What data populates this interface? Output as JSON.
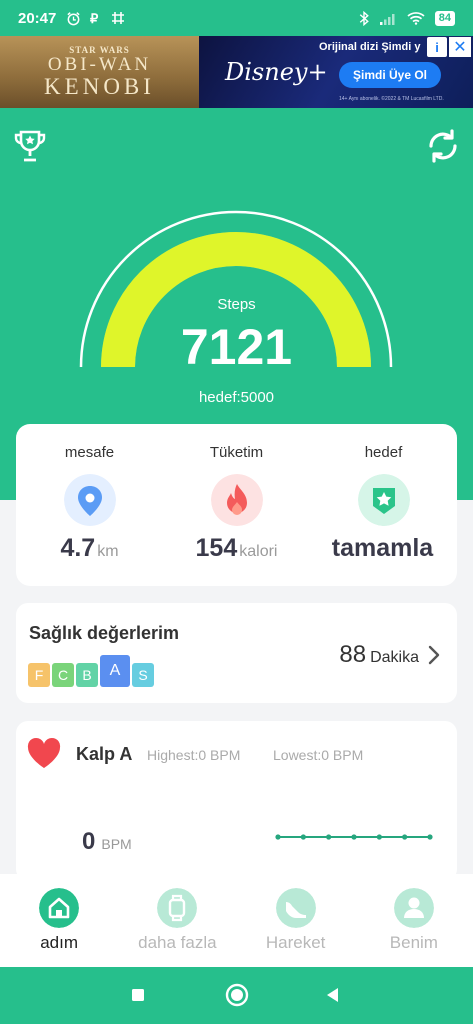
{
  "status_bar": {
    "time": "20:47",
    "left_icons": [
      "alarm-icon",
      "p-icon",
      "grid-icon"
    ],
    "right_icons": [
      "bluetooth-icon",
      "signal-icon",
      "wifi-icon"
    ],
    "battery": "84"
  },
  "ad": {
    "left_small": "STAR WARS",
    "left_line1": "OBI-WAN",
    "left_line2": "KENOBI",
    "brand": "Disney+",
    "top_text": "Orijinal dizi Şimdi y",
    "cta": "Şimdi Üye Ol",
    "fine_print": "14+ Aynı abonelik. ©2022 & TM Lucasfilm LTD."
  },
  "header": {
    "left_button_icon": "trophy-icon",
    "right_button_icon": "refresh-icon"
  },
  "gauge": {
    "label": "Steps",
    "value": "7121",
    "goal_text": "hedef:5000",
    "steps": 7121,
    "goal": 5000,
    "progress_fraction": 1.0,
    "arc_color": "#dff52a",
    "track_color": "#ffffff"
  },
  "stats": [
    {
      "label": "mesafe",
      "value": "4.7",
      "unit": "km",
      "icon": "location-pin-icon",
      "color": "#5b9cf5"
    },
    {
      "label": "Tüketim",
      "value": "154",
      "unit": "kalori",
      "icon": "flame-icon",
      "color": "#f45b5b"
    },
    {
      "label": "hedef",
      "value": "tamamla",
      "unit": "",
      "icon": "star-badge-icon",
      "color": "#2bc48a"
    }
  ],
  "health": {
    "title": "Sağlık değerlerim",
    "grades": [
      {
        "letter": "F",
        "color": "#f6c36a",
        "active": false
      },
      {
        "letter": "C",
        "color": "#7ad47a",
        "active": false
      },
      {
        "letter": "B",
        "color": "#62d3a6",
        "active": false
      },
      {
        "letter": "A",
        "color": "#5b8ff0",
        "active": true
      },
      {
        "letter": "S",
        "color": "#66cde0",
        "active": false
      }
    ],
    "value": "88",
    "unit": "Dakika"
  },
  "heart": {
    "title": "Kalp A",
    "highest": "Highest:0  BPM",
    "lowest": "Lowest:0  BPM",
    "bpm_value": "0",
    "bpm_unit": "BPM",
    "spark_values": [
      0,
      0,
      0,
      0,
      0,
      0,
      0
    ],
    "color": "#f1474e",
    "line_color": "#26a67e"
  },
  "nav": {
    "items": [
      {
        "label": "adım",
        "icon": "home-icon",
        "active": true
      },
      {
        "label": "daha fazla",
        "icon": "watch-icon",
        "active": false
      },
      {
        "label": "Hareket",
        "icon": "shoe-icon",
        "active": false
      },
      {
        "label": "Benim",
        "icon": "person-icon",
        "active": false
      }
    ]
  },
  "system_nav": [
    "square-icon",
    "circle-icon",
    "back-triangle-icon"
  ],
  "colors": {
    "primary": "#26bf8c",
    "background": "#f3f4f6"
  }
}
